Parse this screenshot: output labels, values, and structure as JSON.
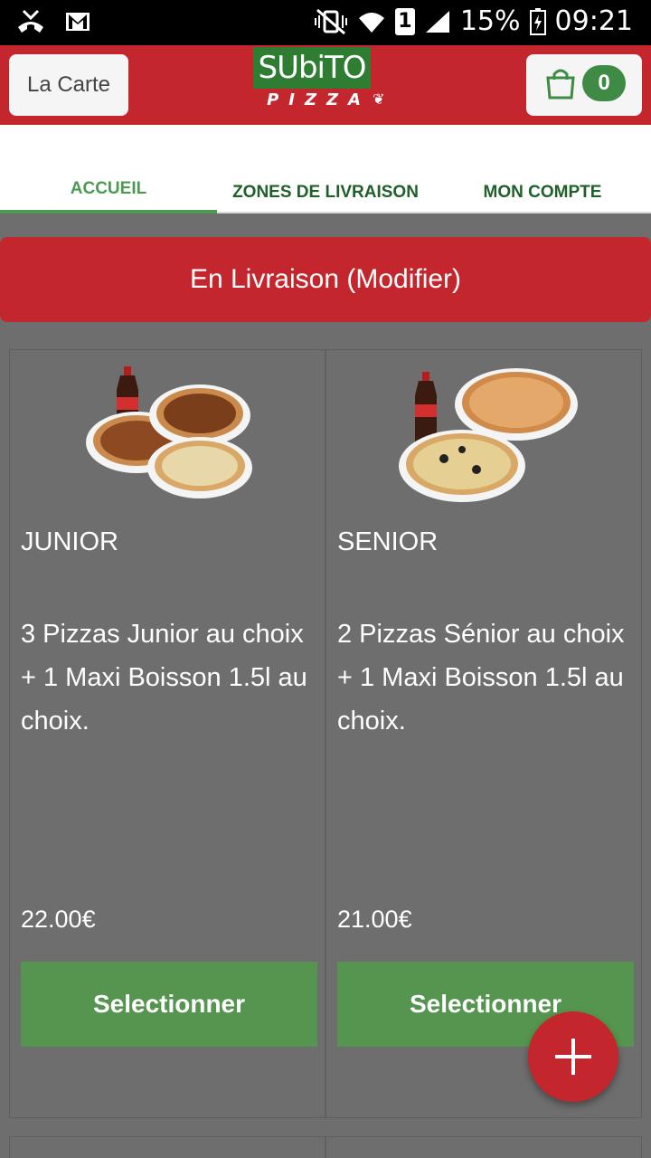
{
  "status_bar": {
    "battery": "15%",
    "time": "09:21",
    "sim_badge": "1",
    "icons": [
      "missed-call-icon",
      "gmail-icon",
      "vibrate-mute-icon",
      "wifi-icon",
      "signal-icon",
      "battery-charging-icon"
    ]
  },
  "header": {
    "menu_label": "La Carte",
    "logo_top": "SUbiTO",
    "logo_bottom": "PIZZA",
    "cart_count": "0"
  },
  "tabs": [
    {
      "label": "ACCUEIL",
      "active": true
    },
    {
      "label": "ZONES DE LIVRAISON",
      "active": false
    },
    {
      "label": "MON COMPTE",
      "active": false
    }
  ],
  "delivery_banner": "En Livraison (Modifier)",
  "products": [
    {
      "title": "JUNIOR",
      "description": "3 Pizzas Junior au choix + 1 Maxi Boisson 1.5l au choix.",
      "price": "22.00€",
      "button": "Selectionner"
    },
    {
      "title": "SENIOR",
      "description": "2 Pizzas Sénior au choix + 1 Maxi Boisson 1.5l au choix.",
      "price": "21.00€",
      "button": "Selectionner"
    }
  ],
  "colors": {
    "brand_red": "#c4262e",
    "brand_green": "#55954f",
    "tab_active": "#4c9a53",
    "background": "#6e6e6e"
  }
}
